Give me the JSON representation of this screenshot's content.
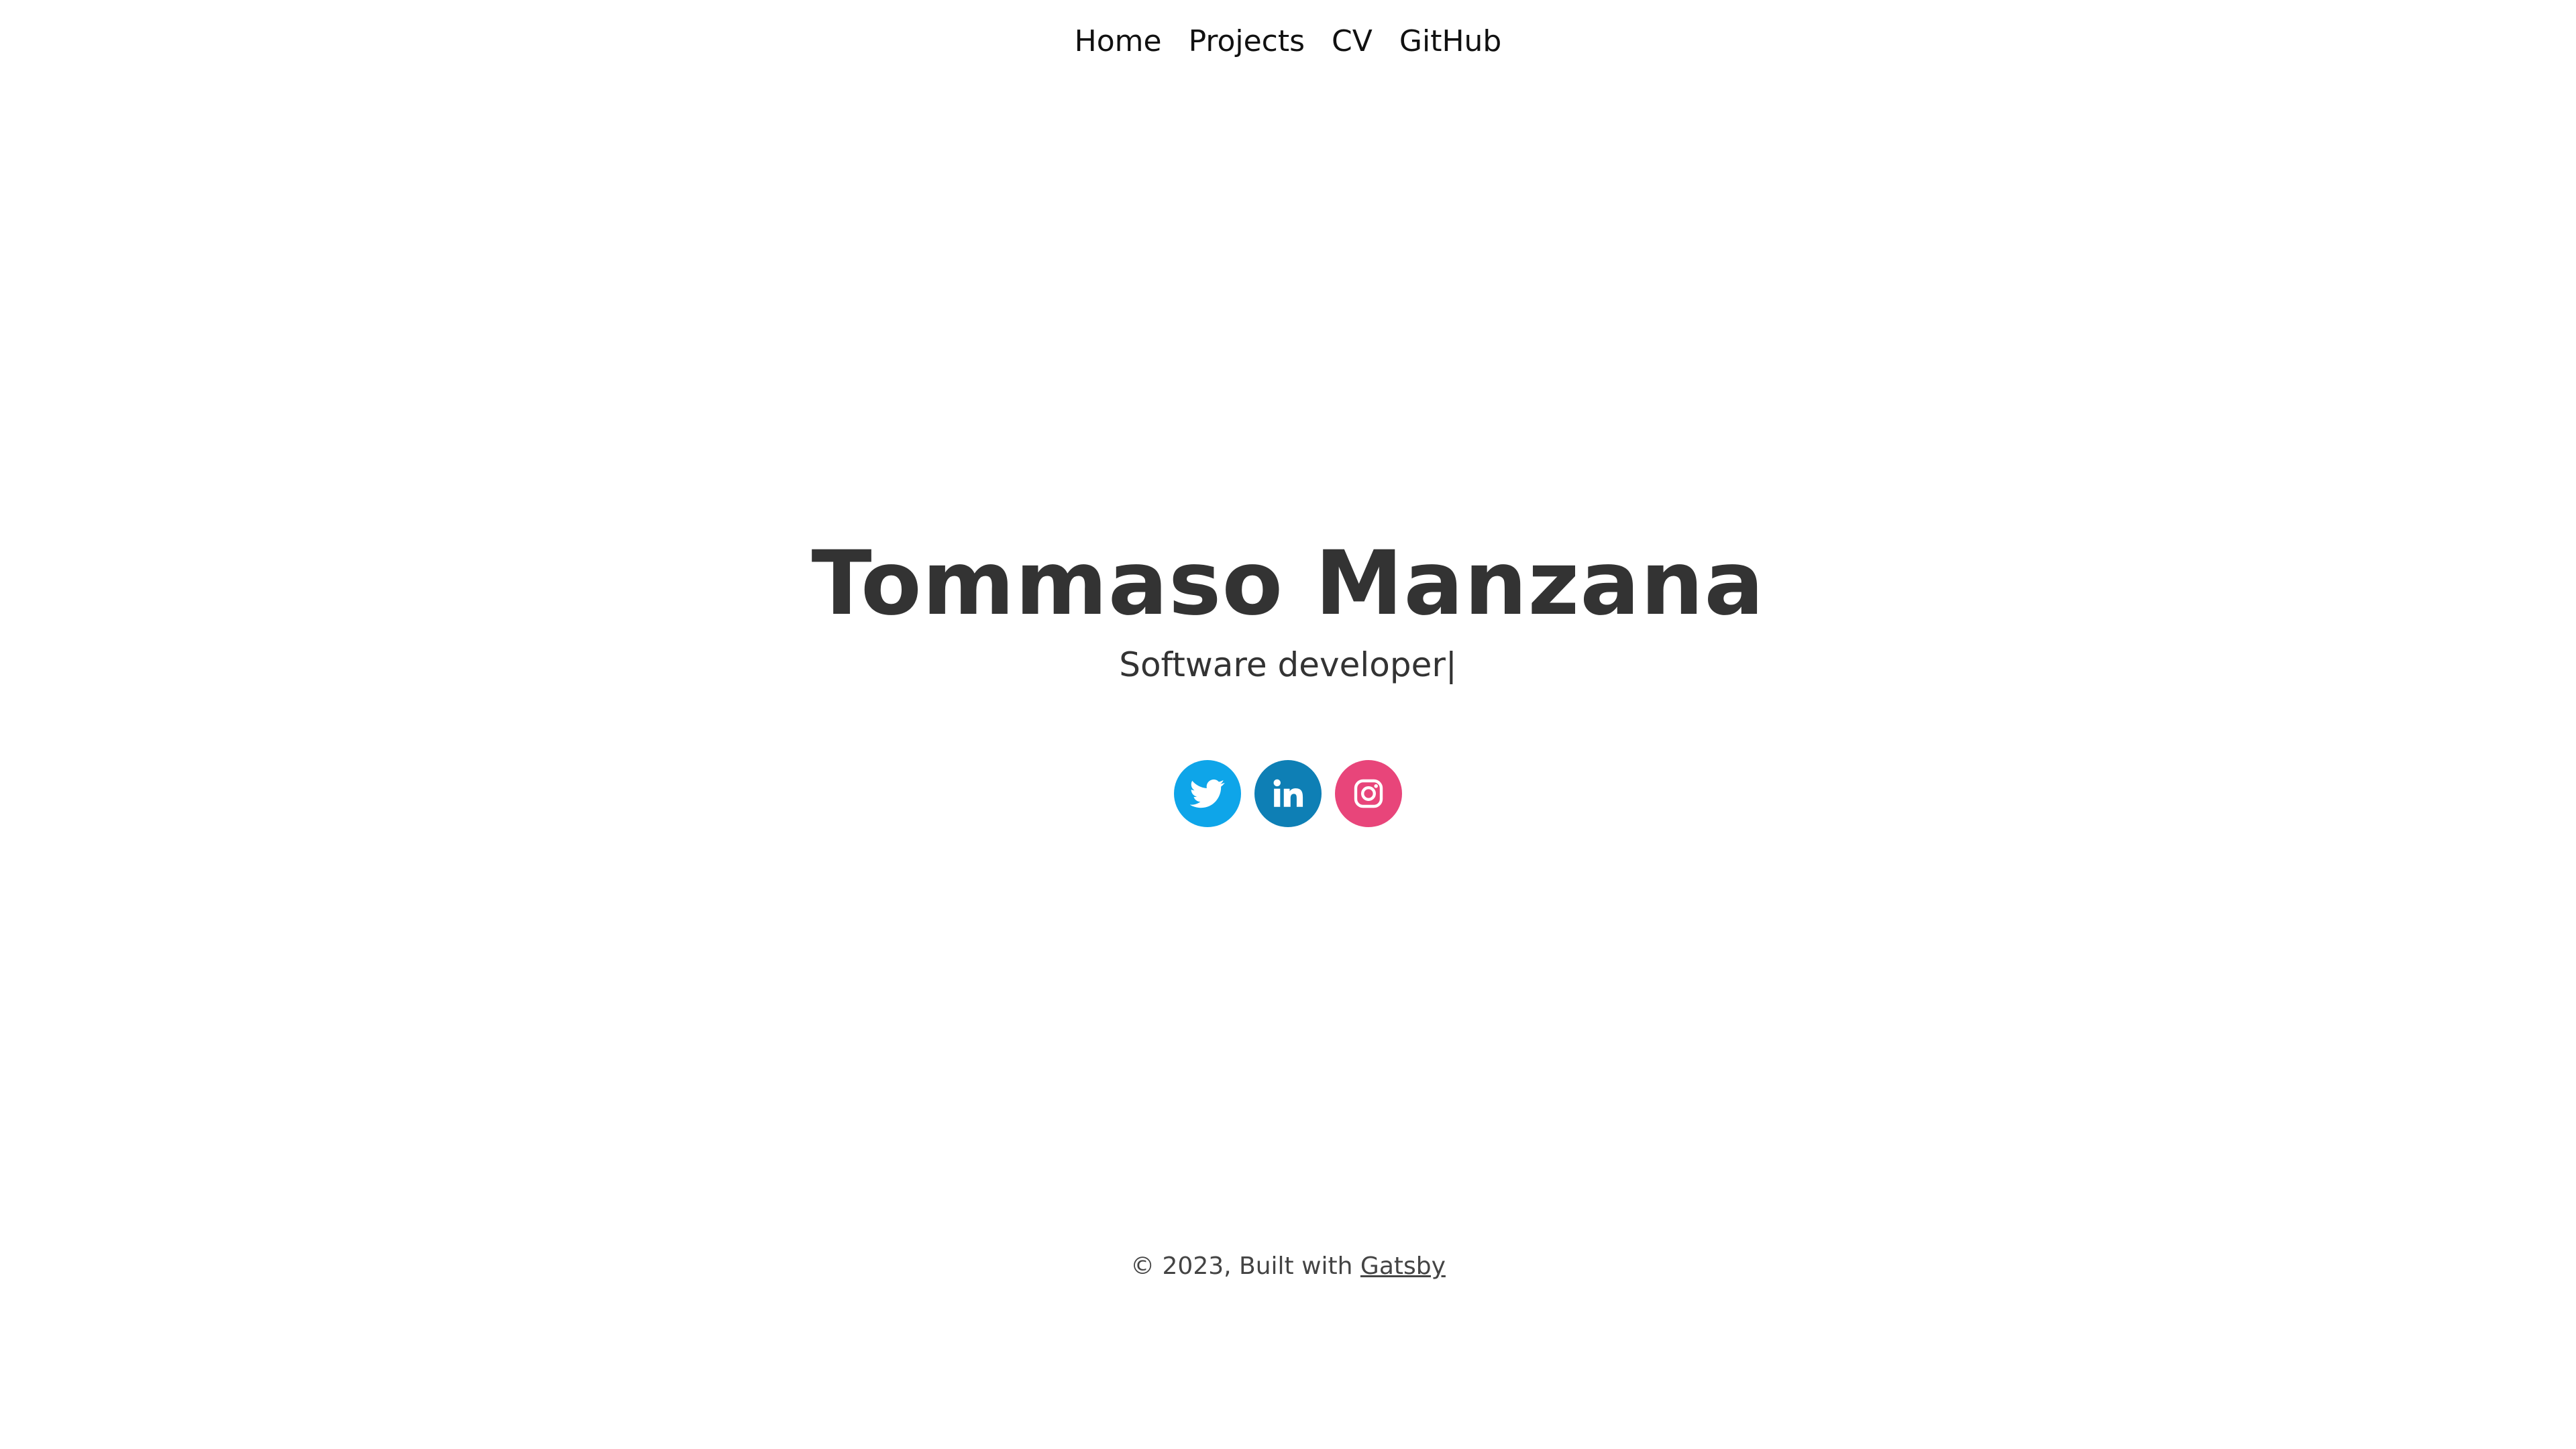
{
  "nav": {
    "items": [
      {
        "label": "Home"
      },
      {
        "label": "Projects"
      },
      {
        "label": "CV"
      },
      {
        "label": "GitHub"
      }
    ]
  },
  "hero": {
    "title": "Tommaso Manzana",
    "subtitle": "Software developer|"
  },
  "socials": {
    "items": [
      {
        "icon": "twitter-icon",
        "color": "#0EA5E9"
      },
      {
        "icon": "linkedin-icon",
        "color": "#0E7FB5"
      },
      {
        "icon": "instagram-icon",
        "color": "#E8457A"
      }
    ]
  },
  "footer": {
    "text": "© 2023, Built with ",
    "link_label": "Gatsby"
  }
}
